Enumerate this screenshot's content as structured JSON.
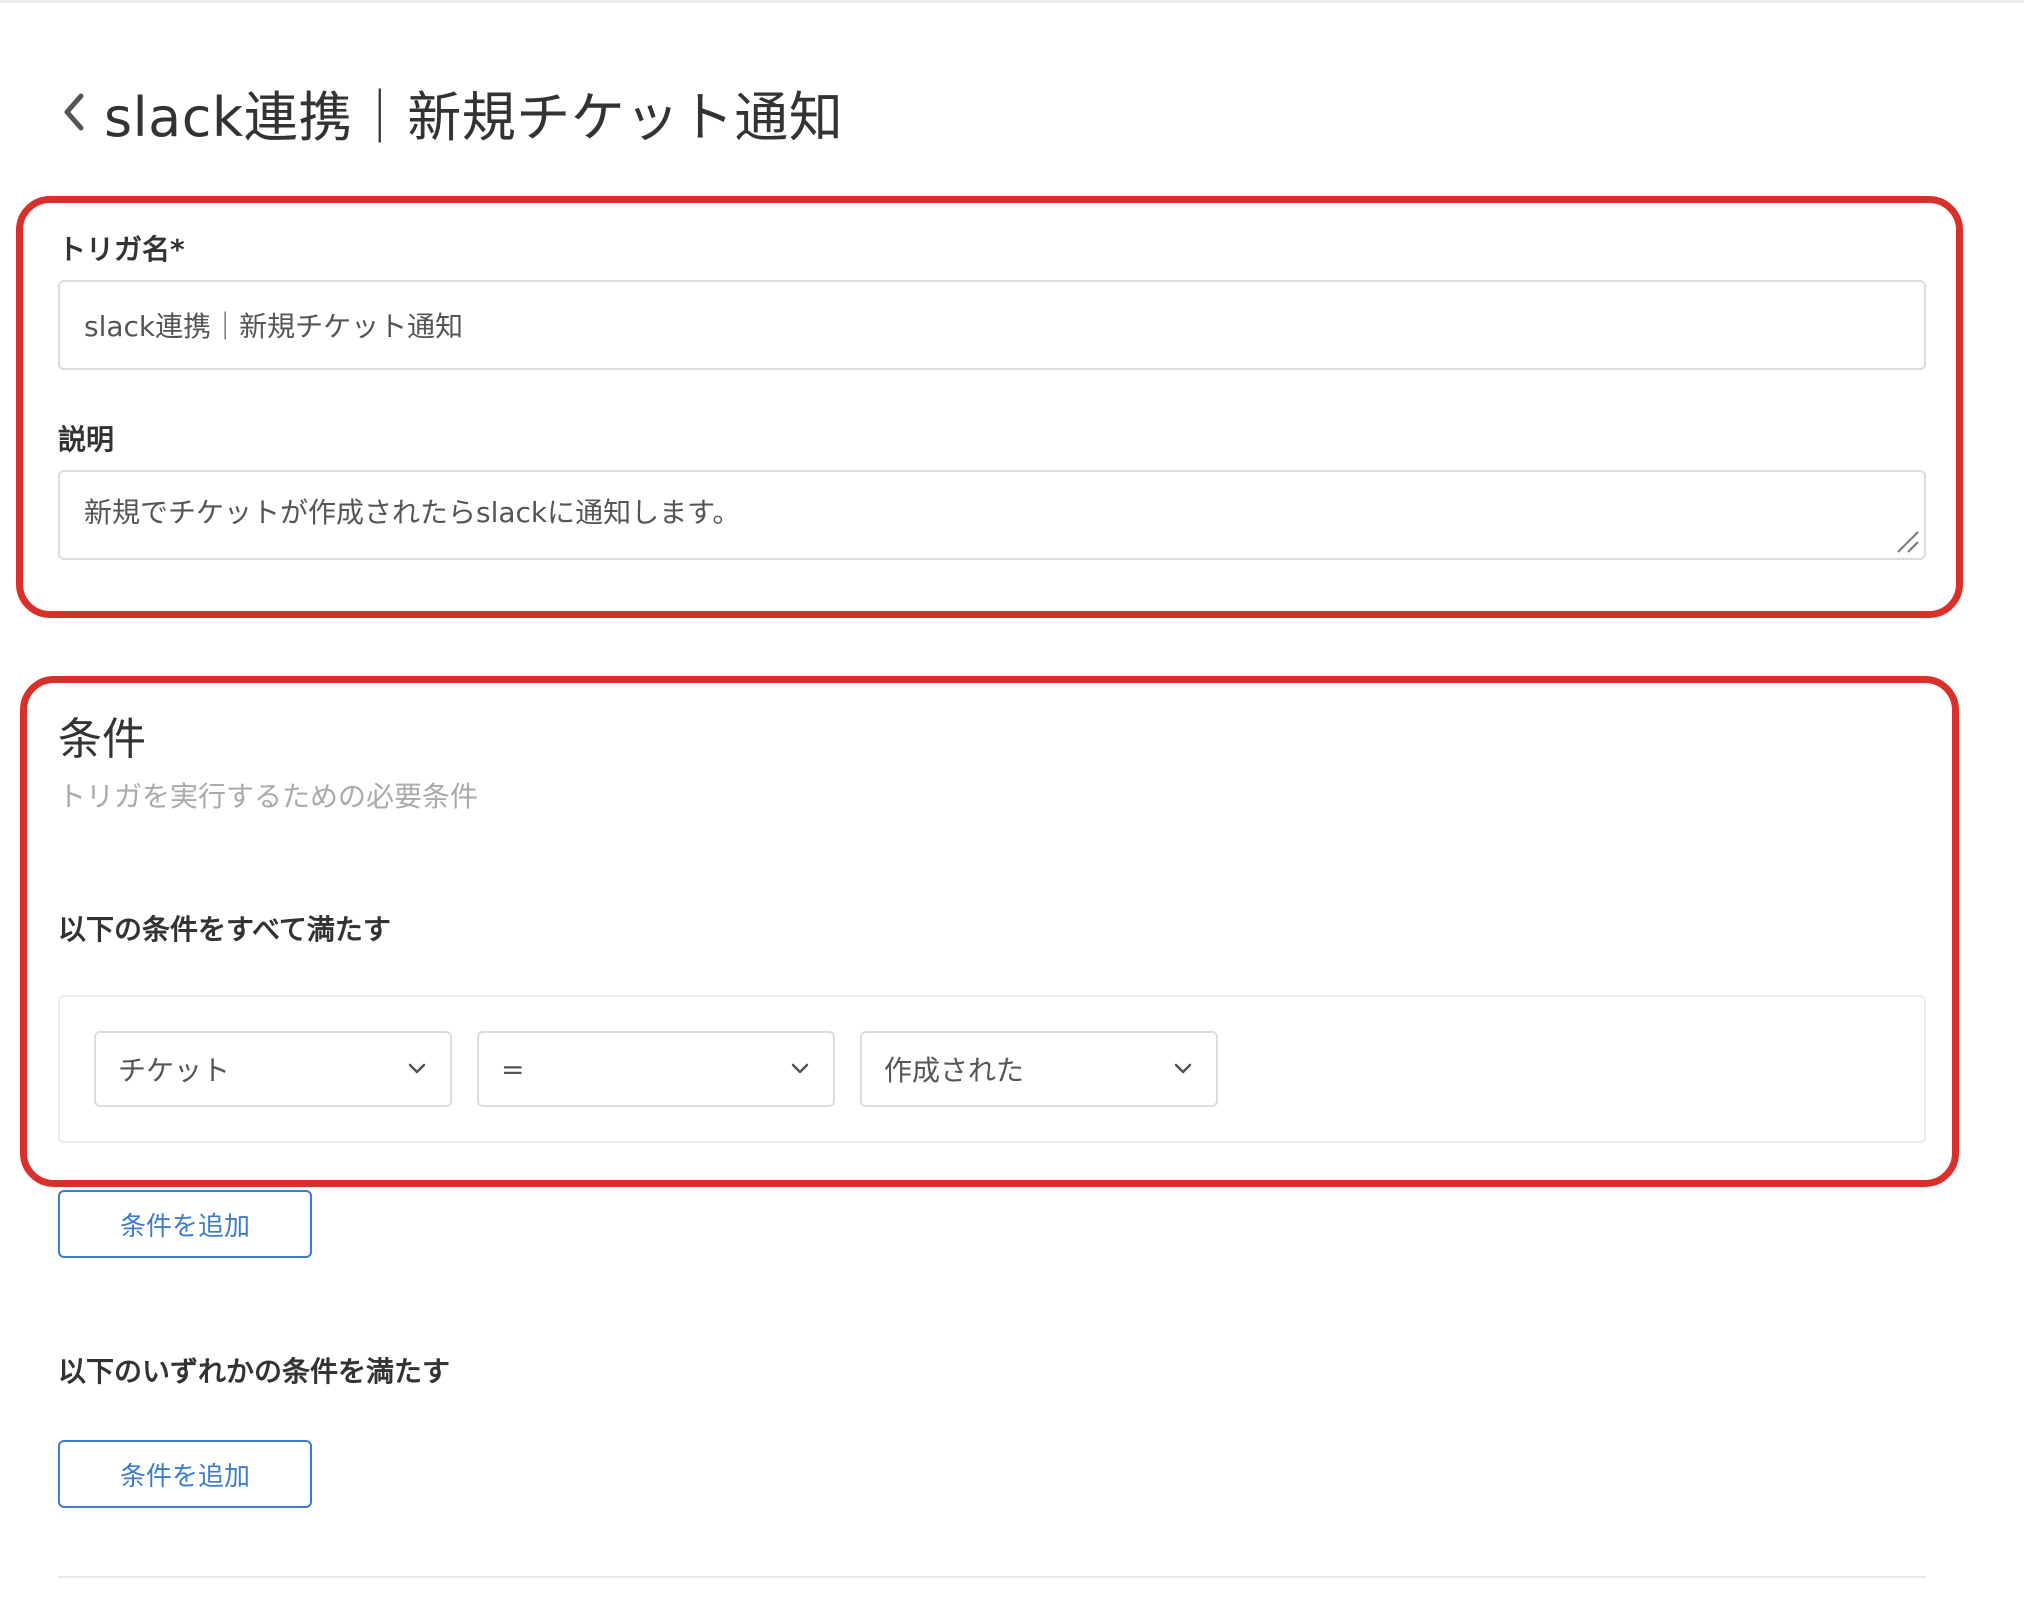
{
  "header": {
    "back_icon": "chevron-left-icon",
    "title": "slack連携｜新規チケット通知"
  },
  "trigger": {
    "name_label": "トリガ名*",
    "name_value": "slack連携｜新規チケット通知",
    "description_label": "説明",
    "description_value": "新規でチケットが作成されたらslackに通知します。"
  },
  "conditions": {
    "title": "条件",
    "subtitle": "トリガを実行するための必要条件",
    "all_label": "以下の条件をすべて満たす",
    "all_rows": [
      {
        "field": "チケット",
        "operator": "=",
        "value": "作成された"
      }
    ],
    "add_all_label": "条件を追加",
    "any_label": "以下のいずれかの条件を満たす",
    "add_any_label": "条件を追加"
  },
  "colors": {
    "highlight": "#d9302c",
    "accent": "#3d7cc9"
  }
}
